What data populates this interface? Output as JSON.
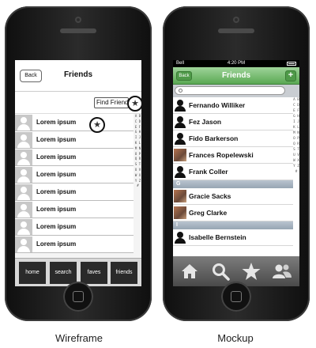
{
  "wireframe": {
    "back_label": "Back",
    "title": "Friends",
    "find_label": "Find Friends",
    "star_icon": "star-icon",
    "rows": [
      "Lorem ipsum",
      "Lorem ipsum",
      "Lorem ipsum",
      "Lorem ipsum",
      "Lorem ipsum",
      "Lorem ipsum",
      "Lorem ipsum",
      "Lorem ipsum"
    ],
    "index": "A B C D E F G H I J K L M N O P Q R S T U V W X Y Z #",
    "tabs": [
      "home",
      "search",
      "faves",
      "friends"
    ]
  },
  "mockup": {
    "status": {
      "carrier": "Bell",
      "time": "4:20 PM"
    },
    "back_label": "Back",
    "title": "Friends",
    "add_label": "+",
    "section_g": "G",
    "section_i": "I",
    "contacts_f": [
      "Fernando Williker",
      "Fez Jason",
      "Fido Barkerson",
      "Frances Ropelewski",
      "Frank Coller"
    ],
    "contacts_g": [
      "Gracie Sacks",
      "Greg Clarke"
    ],
    "contacts_i": [
      "Isabelle Bernstein"
    ],
    "index": "A B C D E F G H I J K L M N O P Q R S T U V W X Y Z #",
    "tab_icons": [
      "home-icon",
      "search-icon",
      "star-icon",
      "friends-icon"
    ]
  },
  "captions": {
    "left": "Wireframe",
    "right": "Mockup"
  }
}
